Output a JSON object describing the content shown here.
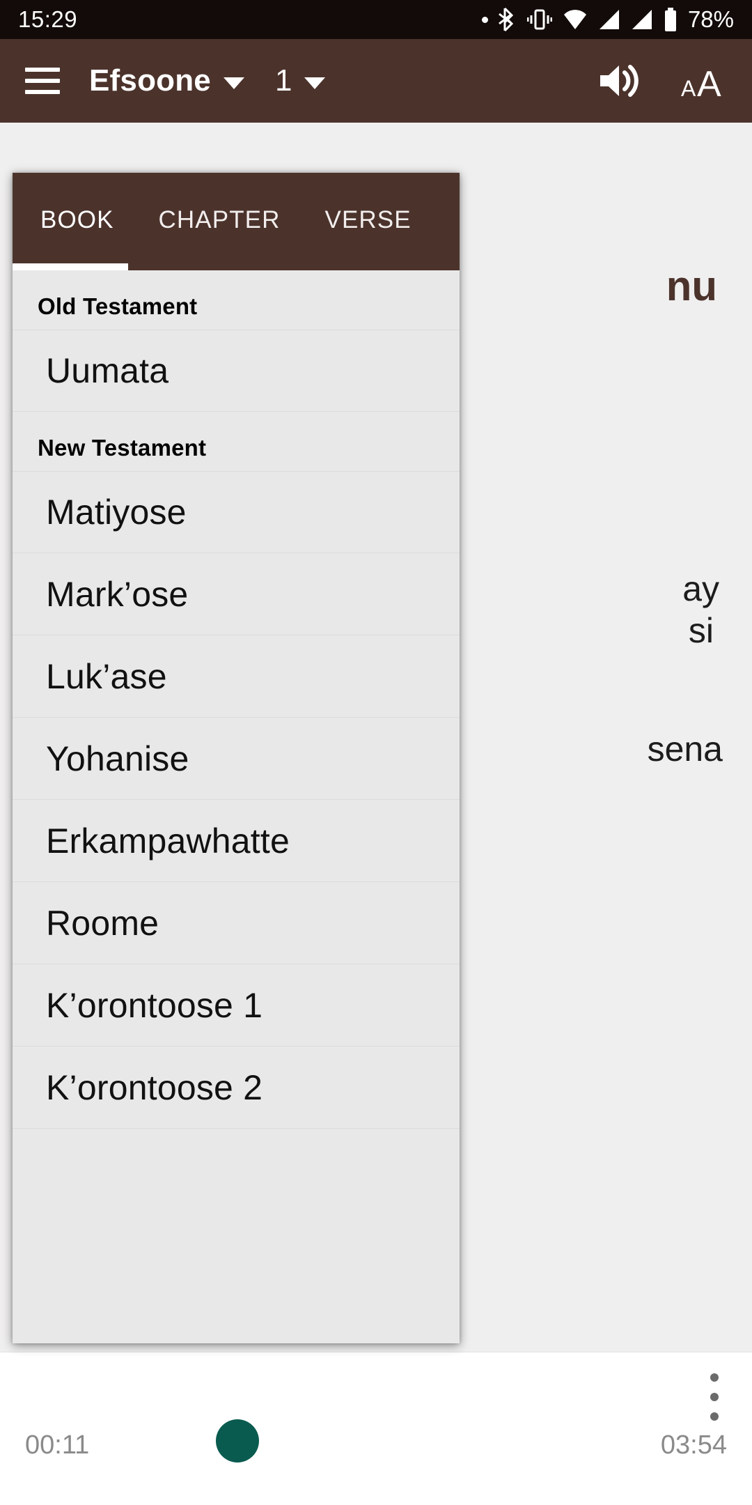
{
  "status_bar": {
    "clock": "15:29",
    "battery_percent": "78%",
    "icons": [
      "dot-icon",
      "bluetooth-icon",
      "vibrate-icon",
      "wifi-icon",
      "signal-icon-1",
      "signal-icon-2",
      "battery-icon"
    ]
  },
  "toolbar": {
    "menu_icon": "hamburger-menu-icon",
    "book_title": "Efsoone",
    "book_caret_icon": "chevron-down-icon",
    "chapter": "1",
    "chapter_caret_icon": "chevron-down-icon",
    "audio_icon": "volume-speaker-icon",
    "text_size_icon": "text-size-icon"
  },
  "selector_panel": {
    "tabs": [
      {
        "label": "BOOK",
        "active": true
      },
      {
        "label": "CHAPTER",
        "active": false
      },
      {
        "label": "VERSE",
        "active": false
      }
    ],
    "sections": [
      {
        "heading": "Old Testament",
        "books": [
          "Uumata"
        ]
      },
      {
        "heading": "New Testament",
        "books": [
          "Matiyose",
          "Mark’ose",
          "Luk’ase",
          "Yohanise",
          "Erkampawhatte",
          "Roome",
          "K’orontoose 1",
          "K’orontoose 2"
        ]
      }
    ]
  },
  "reader": {
    "heading_fragment": "nu",
    "line_fragment_1": "ay",
    "line_fragment_2": "si",
    "line_fragment_3": "sena"
  },
  "player": {
    "elapsed": "00:11",
    "remaining": "03:54",
    "play_button_icon": "play-circle-icon",
    "overflow_icon": "more-vertical-icon"
  },
  "colors": {
    "toolbar_brown": "#4b332c",
    "status_bar": "#130b09",
    "panel_bg": "#e8e8e8",
    "reader_bg": "#f0efef",
    "accent_teal": "#0a5b4f",
    "muted_text": "#8a8a8a"
  }
}
